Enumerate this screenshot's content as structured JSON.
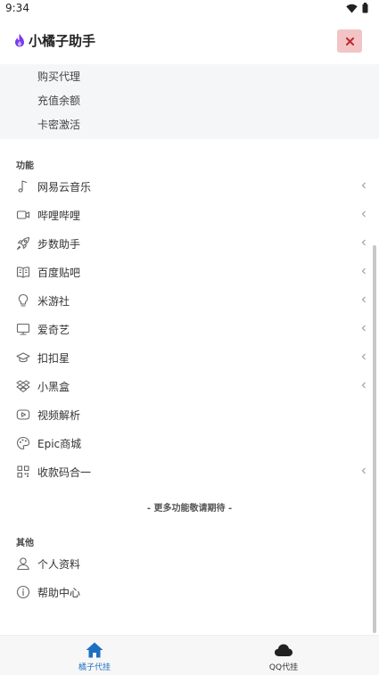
{
  "status_bar": {
    "time": "9:34"
  },
  "header": {
    "title": "小橘子助手",
    "close_label": "×"
  },
  "sub_items": [
    "购买代理",
    "充值余额",
    "卡密激活"
  ],
  "features": {
    "label": "功能",
    "items": [
      {
        "label": "网易云音乐",
        "icon": "music-note-icon",
        "has_chevron": true
      },
      {
        "label": "哔哩哔哩",
        "icon": "video-camera-icon",
        "has_chevron": true
      },
      {
        "label": "步数助手",
        "icon": "rocket-icon",
        "has_chevron": true
      },
      {
        "label": "百度贴吧",
        "icon": "book-open-icon",
        "has_chevron": true
      },
      {
        "label": "米游社",
        "icon": "lightbulb-icon",
        "has_chevron": true
      },
      {
        "label": "爱奇艺",
        "icon": "tv-icon",
        "has_chevron": true
      },
      {
        "label": "扣扣星",
        "icon": "graduation-cap-icon",
        "has_chevron": true
      },
      {
        "label": "小黑盒",
        "icon": "dropbox-icon",
        "has_chevron": true
      },
      {
        "label": "视频解析",
        "icon": "youtube-icon",
        "has_chevron": false
      },
      {
        "label": "Epic商城",
        "icon": "palette-icon",
        "has_chevron": false
      },
      {
        "label": "收款码合一",
        "icon": "qrcode-icon",
        "has_chevron": true
      }
    ]
  },
  "more_note": "- 更多功能敬请期待 -",
  "others": {
    "label": "其他",
    "items": [
      {
        "label": "个人资料",
        "icon": "user-icon"
      },
      {
        "label": "帮助中心",
        "icon": "info-circle-icon"
      }
    ]
  },
  "bottom_nav": {
    "tabs": [
      {
        "label": "橘子代挂",
        "icon": "home-icon",
        "active": true
      },
      {
        "label": "QQ代挂",
        "icon": "cloud-icon",
        "active": false
      }
    ]
  },
  "colors": {
    "accent": "#1e6fc2",
    "close_bg": "#f2c4c6",
    "close_fg": "#c0282d",
    "logo": "#7c3aed"
  }
}
